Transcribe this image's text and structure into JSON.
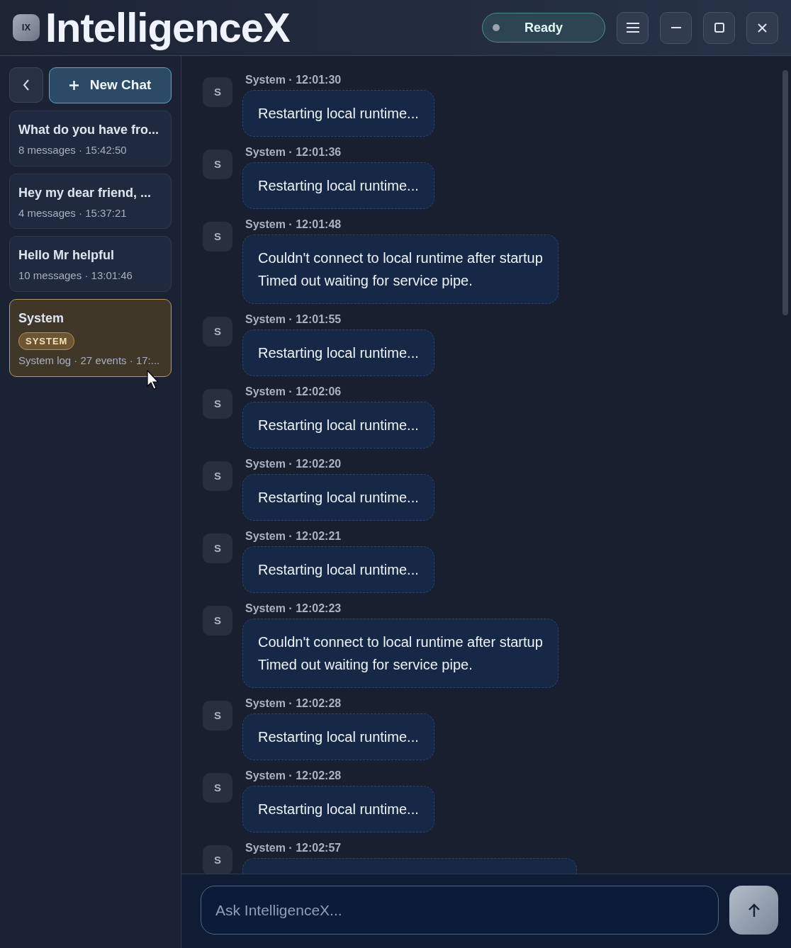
{
  "app": {
    "logo": "IX",
    "title": "IntelligenceX",
    "status": "Ready"
  },
  "sidebar": {
    "new_chat": "New Chat",
    "chats": [
      {
        "title": "What do you have fro...",
        "meta": "8 messages · 15:42:50",
        "selected": false
      },
      {
        "title": "Hey my dear friend, ...",
        "meta": "4 messages · 15:37:21",
        "selected": false
      },
      {
        "title": "Hello Mr helpful",
        "meta": "10 messages · 13:01:46",
        "selected": false
      },
      {
        "title": "System",
        "badge": "SYSTEM",
        "meta": "System log · 27 events · 17:...",
        "selected": true
      }
    ]
  },
  "messages": [
    {
      "avatar": "S",
      "header": "System · 12:01:30",
      "text": "Restarting local runtime..."
    },
    {
      "avatar": "S",
      "header": "System · 12:01:36",
      "text": "Restarting local runtime..."
    },
    {
      "avatar": "S",
      "header": "System · 12:01:48",
      "text": "Couldn't connect to local runtime after startup\nTimed out waiting for service pipe."
    },
    {
      "avatar": "S",
      "header": "System · 12:01:55",
      "text": "Restarting local runtime..."
    },
    {
      "avatar": "S",
      "header": "System · 12:02:06",
      "text": "Restarting local runtime..."
    },
    {
      "avatar": "S",
      "header": "System · 12:02:20",
      "text": "Restarting local runtime..."
    },
    {
      "avatar": "S",
      "header": "System · 12:02:21",
      "text": "Restarting local runtime..."
    },
    {
      "avatar": "S",
      "header": "System · 12:02:23",
      "text": "Couldn't connect to local runtime after startup\nTimed out waiting for service pipe."
    },
    {
      "avatar": "S",
      "header": "System · 12:02:28",
      "text": "Restarting local runtime..."
    },
    {
      "avatar": "S",
      "header": "System · 12:02:28",
      "text": "Restarting local runtime..."
    },
    {
      "avatar": "S",
      "header": "System · 12:02:57"
    }
  ],
  "composer": {
    "placeholder": "Ask IntelligenceX..."
  }
}
